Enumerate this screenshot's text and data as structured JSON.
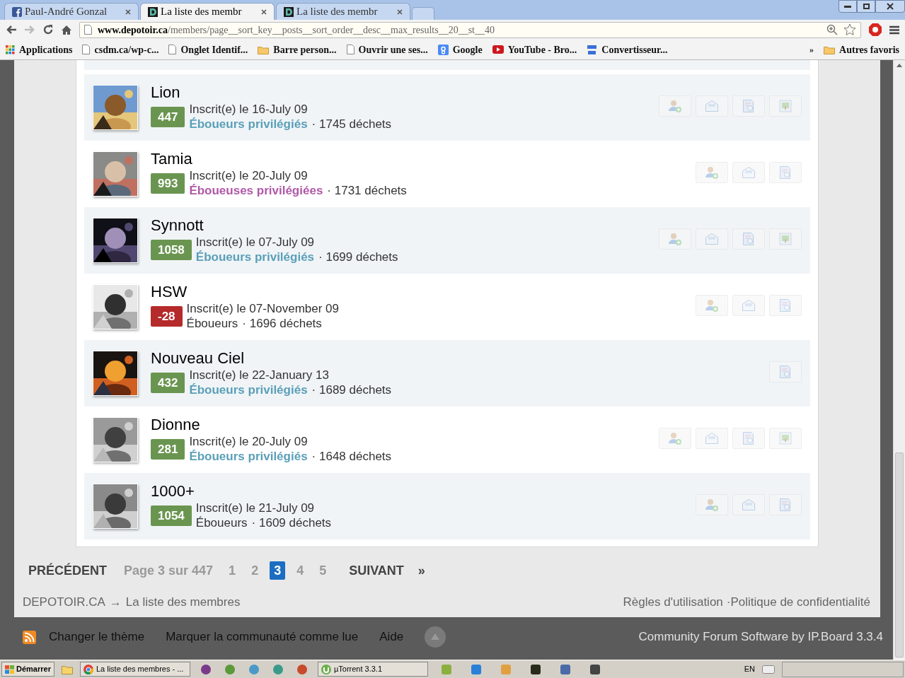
{
  "browser": {
    "tabs": [
      {
        "title": "Paul-André Gonzal",
        "selected": false
      },
      {
        "title": "La liste des membr",
        "selected": true
      },
      {
        "title": "La liste des membr",
        "selected": false
      }
    ],
    "url_host": "www.depotoir.ca",
    "url_path": "/members/page__sort_key__posts__sort_order__desc__max_results__20__st__40",
    "bookmarks": [
      "Applications",
      "csdm.ca/wp-c...",
      "Onglet Identif...",
      "Barre person...",
      "Ouvrir une ses...",
      "Google",
      "YouTube - Bro...",
      "Convertisseur..."
    ],
    "more": "»",
    "other_bookmarks": "Autres favoris"
  },
  "members": [
    {
      "name": "Lion",
      "reputation": {
        "value": "447",
        "color": "#6a9550"
      },
      "joined": "Inscrit(e) le 16-July 09",
      "group": {
        "name": "Éboueurs privilégiés",
        "color": "#5a9fb8"
      },
      "posts": "· 1745 déchets",
      "actions": [
        {
          "kind": "friend"
        },
        {
          "kind": "message"
        },
        {
          "kind": "content"
        },
        {
          "kind": "gallery"
        }
      ]
    },
    {
      "name": "Tamia",
      "reputation": {
        "value": "993",
        "color": "#6a9550"
      },
      "joined": "Inscrit(e) le 20-July 09",
      "group": {
        "name": "Éboueuses privilégiées",
        "color": "#b058a8"
      },
      "posts": "· 1731 déchets",
      "actions": [
        {
          "kind": "friend"
        },
        {
          "kind": "message"
        },
        {
          "kind": "content"
        }
      ]
    },
    {
      "name": "Synnott",
      "reputation": {
        "value": "1058",
        "color": "#6a9550"
      },
      "joined": "Inscrit(e) le 07-July 09",
      "group": {
        "name": "Éboueurs privilégiés",
        "color": "#5a9fb8"
      },
      "posts": "· 1699 déchets",
      "actions": [
        {
          "kind": "friend"
        },
        {
          "kind": "message"
        },
        {
          "kind": "content"
        },
        {
          "kind": "gallery"
        }
      ]
    },
    {
      "name": "HSW",
      "reputation": {
        "value": "-28",
        "color": "#b52a2a"
      },
      "joined": "Inscrit(e) le 07-November 09",
      "group": {
        "name": "Éboueurs",
        "color": "#333333"
      },
      "posts": "· 1696 déchets",
      "actions": [
        {
          "kind": "friend"
        },
        {
          "kind": "message"
        },
        {
          "kind": "content"
        }
      ]
    },
    {
      "name": "Nouveau Ciel",
      "reputation": {
        "value": "432",
        "color": "#6a9550"
      },
      "joined": "Inscrit(e) le 22-January 13",
      "group": {
        "name": "Éboueurs privilégiés",
        "color": "#5a9fb8"
      },
      "posts": "· 1689 déchets",
      "actions": [
        {
          "kind": "content"
        }
      ]
    },
    {
      "name": "Dionne",
      "reputation": {
        "value": "281",
        "color": "#6a9550"
      },
      "joined": "Inscrit(e) le 20-July 09",
      "group": {
        "name": "Éboueurs privilégiés",
        "color": "#5a9fb8"
      },
      "posts": "· 1648 déchets",
      "actions": [
        {
          "kind": "friend"
        },
        {
          "kind": "message"
        },
        {
          "kind": "content"
        },
        {
          "kind": "gallery"
        }
      ]
    },
    {
      "name": "1000+",
      "reputation": {
        "value": "1054",
        "color": "#6a9550"
      },
      "joined": "Inscrit(e) le 21-July 09",
      "group": {
        "name": "Éboueurs",
        "color": "#333333"
      },
      "posts": "· 1609 déchets",
      "actions": [
        {
          "kind": "friend"
        },
        {
          "kind": "message"
        },
        {
          "kind": "content"
        }
      ]
    }
  ],
  "pagination": {
    "previous": "PRÉCÉDENT",
    "info": "Page 3 sur 447",
    "pages": [
      {
        "label": "1",
        "selected": false
      },
      {
        "label": "2",
        "selected": false
      },
      {
        "label": "3",
        "selected": true
      },
      {
        "label": "4",
        "selected": false
      },
      {
        "label": "5",
        "selected": false
      }
    ],
    "next": "SUIVANT",
    "last": "»"
  },
  "breadcrumb": {
    "home": "DEPOTOIR.CA",
    "arrow": "→",
    "current": "La liste des membres"
  },
  "legal": {
    "links": [
      "Règles d'utilisation",
      "Politique de confidentialité"
    ],
    "separator": "·"
  },
  "footer": {
    "links": [
      "Changer le thème",
      "Marquer la communauté comme lue",
      "Aide"
    ],
    "credit": "Community Forum Software by IP.Board 3.3.4"
  },
  "taskbar": {
    "start": "Démarrer",
    "windows": [
      "La liste des membres - ...",
      "µTorrent 3.3.1"
    ],
    "language": "EN"
  }
}
